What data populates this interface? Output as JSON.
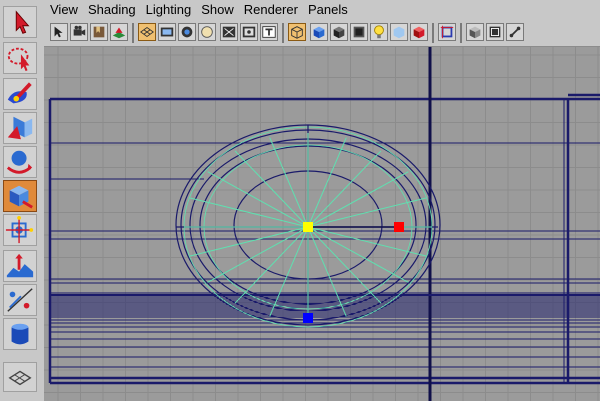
{
  "menu": {
    "items": [
      "View",
      "Shading",
      "Lighting",
      "Show",
      "Renderer",
      "Panels"
    ]
  },
  "toolbox": {
    "tools": [
      {
        "icon": "select-arrow-icon",
        "active": false
      },
      {
        "icon": "lasso-select-icon",
        "active": false
      },
      {
        "icon": "paint-select-icon",
        "active": false
      },
      {
        "icon": "move-tool-icon",
        "active": false
      },
      {
        "icon": "rotate-tool-icon",
        "active": false
      },
      {
        "icon": "scale-tool-icon",
        "active": true
      },
      {
        "icon": "universal-manipulator-icon",
        "active": false
      },
      {
        "icon": "soft-modification-icon",
        "active": false
      },
      {
        "icon": "show-manipulator-icon",
        "active": false
      },
      {
        "icon": "last-tool-icon",
        "active": false
      }
    ],
    "layout_button": {
      "icon": "single-perspective-layout-icon"
    }
  },
  "panel_toolbar": {
    "icons": [
      "select-camera-icon",
      "camera-attributes-icon",
      "bookmarks-icon",
      "image-plane-icon",
      "grid-icon",
      "film-gate-icon",
      "resolution-gate-icon",
      "gate-mask-icon",
      "field-chart-icon",
      "safe-action-icon",
      "safe-title-icon",
      "wireframe-icon",
      "smooth-shade-icon",
      "flat-shade-icon",
      "bounding-box-icon",
      "use-default-lights-icon",
      "shadows-icon",
      "textured-icon",
      "isolate-select-icon",
      "xray-icon",
      "xray-joints-icon"
    ],
    "active_icon": "wireframe-icon"
  },
  "viewport": {
    "background": "#9b9b9b",
    "grid_color": "#8c8c8c",
    "wire_color": "#1a1a6a",
    "spoke_color": "#5fe0b0",
    "pivot_color": "#ffff00",
    "handle_x_color": "#ff0000",
    "handle_z_color": "#0000ff",
    "spokes": 20
  }
}
